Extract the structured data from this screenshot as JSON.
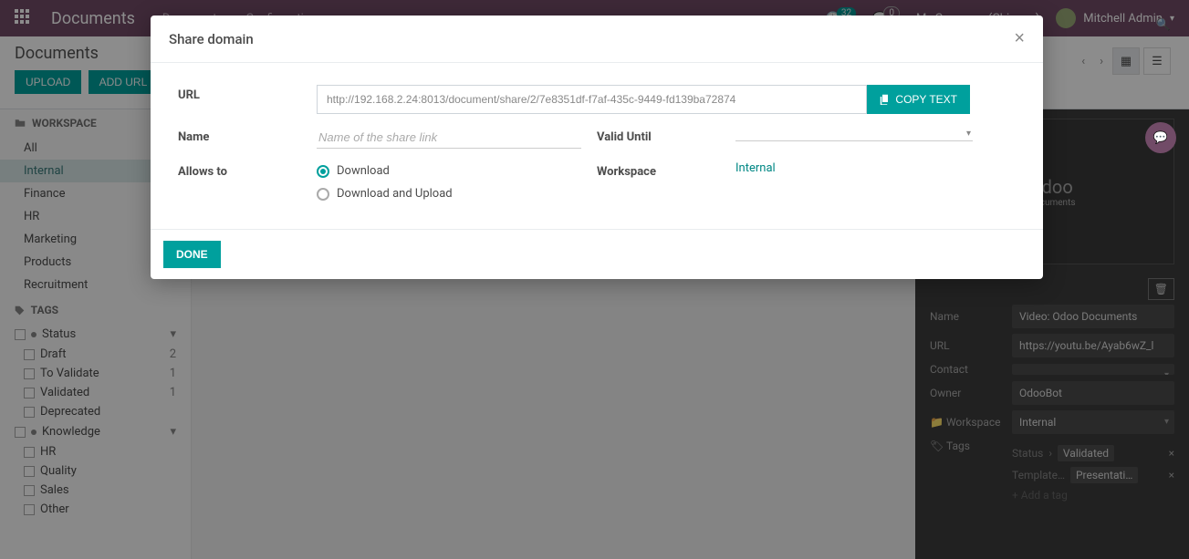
{
  "topbar": {
    "brand": "Documents",
    "nav": [
      "Documents",
      "Configuration"
    ],
    "clock_badge": "32",
    "chat_badge": "0",
    "company": "My Company (Chicago)",
    "user": "Mitchell Admin"
  },
  "header": {
    "title": "Documents",
    "upload": "UPLOAD",
    "add_url": "ADD URL"
  },
  "sidebar": {
    "workspace_header": "WORKSPACE",
    "workspace_items": [
      "All",
      "Internal",
      "Finance",
      "HR",
      "Marketing",
      "Products",
      "Recruitment"
    ],
    "workspace_active": "Internal",
    "tags_header": "TAGS",
    "group_status": {
      "label": "Status",
      "items": [
        {
          "label": "Draft",
          "count": "2"
        },
        {
          "label": "To Validate",
          "count": "1"
        },
        {
          "label": "Validated",
          "count": "1"
        },
        {
          "label": "Deprecated",
          "count": ""
        }
      ]
    },
    "group_knowledge": {
      "label": "Knowledge",
      "items": [
        {
          "label": "HR",
          "count": ""
        },
        {
          "label": "Quality",
          "count": ""
        },
        {
          "label": "Sales",
          "count": ""
        },
        {
          "label": "Other",
          "count": ""
        }
      ]
    }
  },
  "rightpanel": {
    "doc_brand": "odoo",
    "doc_sub": "Documents",
    "name_label": "Name",
    "name_value": "Video: Odoo Documents",
    "url_label": "URL",
    "url_value": "https://youtu.be/Ayab6wZ_l",
    "contact_label": "Contact",
    "contact_value": "",
    "owner_label": "Owner",
    "owner_value": "OdooBot",
    "workspace_label": "Workspace",
    "workspace_value": "Internal",
    "tags_label": "Tags",
    "tag1_cat": "Status",
    "tag1_val": "Validated",
    "tag2_cat": "Template…",
    "tag2_val": "Presentati…",
    "add_tag": "+ Add a tag"
  },
  "modal": {
    "title": "Share domain",
    "url_label": "URL",
    "url_value": "http://192.168.2.24:8013/document/share/2/7e8351df-f7af-435c-9449-fd139ba72874",
    "copy_button": "COPY TEXT",
    "name_label": "Name",
    "name_placeholder": "Name of the share link",
    "valid_until_label": "Valid Until",
    "allows_label": "Allows to",
    "allows_opt_download": "Download",
    "allows_opt_both": "Download and Upload",
    "workspace_label": "Workspace",
    "workspace_value": "Internal",
    "done": "DONE"
  }
}
